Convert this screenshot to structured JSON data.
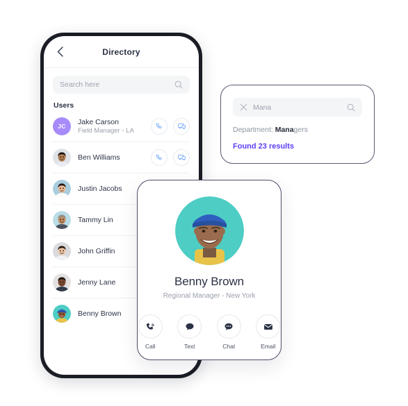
{
  "phone": {
    "header": {
      "back_icon": "chevron-left-icon",
      "title": "Directory"
    },
    "search": {
      "placeholder": "Search here",
      "value": "",
      "icon": "search-icon"
    },
    "section_label": "Users",
    "row_action_icons": [
      "phone-icon",
      "chat-icon"
    ],
    "users": [
      {
        "name": "Jake Carson",
        "subtitle": "Field Manager - LA",
        "avatar_type": "initials",
        "initials": "JC",
        "avatar_color": "#a78bfa",
        "has_actions": true
      },
      {
        "name": "Ben Williams",
        "subtitle": "",
        "avatar_type": "photo",
        "avatar_color": "#dfe3e8",
        "has_actions": true
      },
      {
        "name": "Justin Jacobs",
        "subtitle": "",
        "avatar_type": "photo",
        "avatar_color": "#a9ccdf",
        "has_actions": false
      },
      {
        "name": "Tammy Lin",
        "subtitle": "",
        "avatar_type": "photo",
        "avatar_color": "#b9dce6",
        "has_actions": false
      },
      {
        "name": "John Griffin",
        "subtitle": "",
        "avatar_type": "photo",
        "avatar_color": "#d8dadd",
        "has_actions": false
      },
      {
        "name": "Jenny Lane",
        "subtitle": "",
        "avatar_type": "photo",
        "avatar_color": "#e3e1e0",
        "has_actions": false
      },
      {
        "name": "Benny Brown",
        "subtitle": "",
        "avatar_type": "photo",
        "avatar_color": "#4ecdc4",
        "has_actions": false
      }
    ]
  },
  "search_card": {
    "clear_icon": "close-icon",
    "search_icon": "search-icon",
    "query": "Mana",
    "department_prefix": "Department: ",
    "department_match": "Mana",
    "department_rest": "gers",
    "results_text": "Found 23 results",
    "results_color": "#5b3df5"
  },
  "profile_card": {
    "avatar_bg": "#4ecdc4",
    "name": "Benny Brown",
    "role": "Regional Manager - New York",
    "actions": [
      {
        "label": "Call",
        "icon": "phone-icon"
      },
      {
        "label": "Text",
        "icon": "speech-bubble-icon"
      },
      {
        "label": "Chat",
        "icon": "chat-dots-icon"
      },
      {
        "label": "Email",
        "icon": "envelope-icon"
      }
    ]
  }
}
